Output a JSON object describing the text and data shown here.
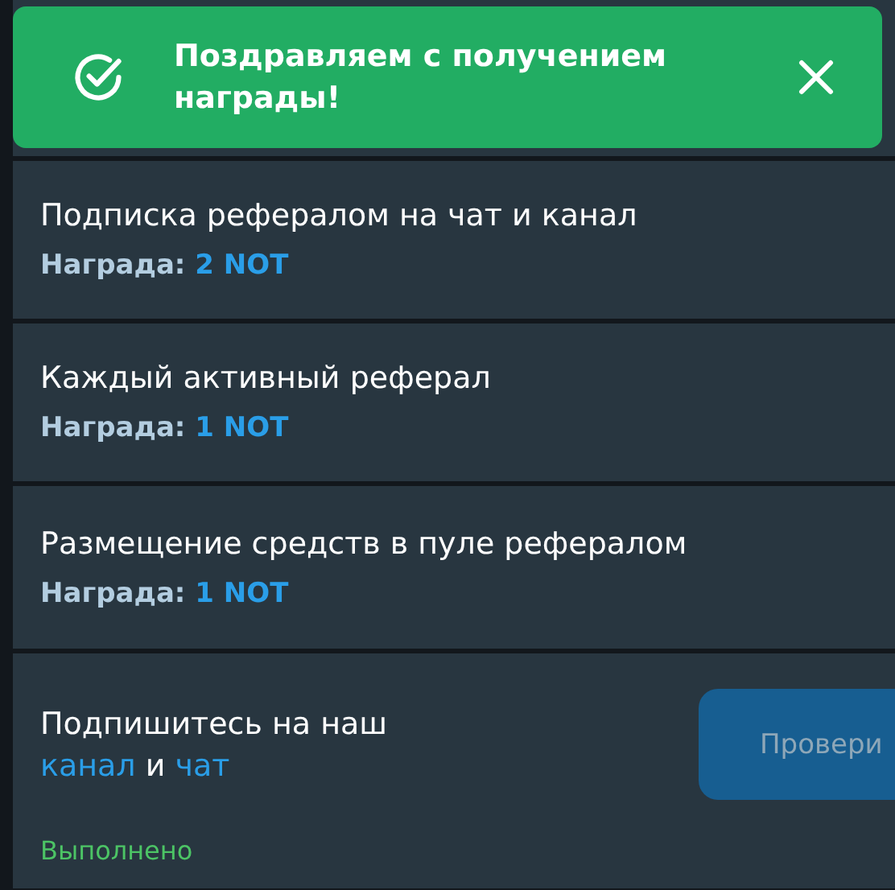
{
  "toast": {
    "message": "Поздравляем с получением награды!",
    "kind": "success"
  },
  "tasks": [
    {
      "title": "Подписка рефералом на чат и канал",
      "reward_label": "Награда:",
      "reward": "2 NOT"
    },
    {
      "title": "Каждый активный реферал",
      "reward_label": "Награда:",
      "reward": "1 NOT"
    },
    {
      "title": "Размещение средств в пуле рефералом",
      "reward_label": "Награда:",
      "reward": "1 NOT"
    }
  ],
  "subscribe": {
    "text": "Подпишитесь на наш",
    "link_1": "канал",
    "joiner": "и",
    "link_2": "чат",
    "status": "Выполнено",
    "button": {
      "label": "Провери",
      "disabled": true
    }
  }
}
